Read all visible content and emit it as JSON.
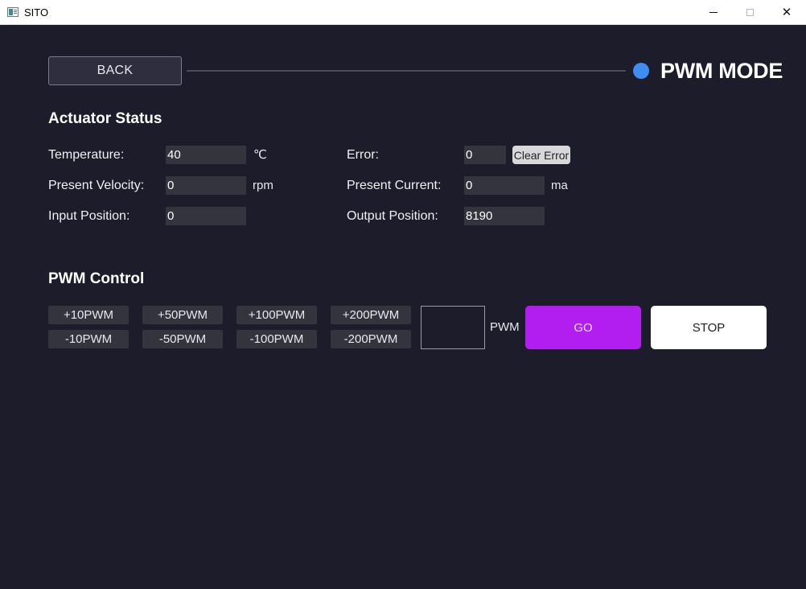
{
  "window": {
    "title": "SITO",
    "minimize_icon": "minimize-icon",
    "maximize_icon": "maximize-icon",
    "close_glyph": "✕"
  },
  "header": {
    "back_label": "BACK",
    "mode_title": "PWM MODE",
    "mode_indicator_color": "#3d8ef0"
  },
  "actuator_status": {
    "title": "Actuator Status",
    "temperature": {
      "label": "Temperature:",
      "value": "40",
      "unit": "℃"
    },
    "present_velocity": {
      "label": "Present Velocity:",
      "value": "0",
      "unit": "rpm"
    },
    "input_position": {
      "label": "Input Position:",
      "value": "0"
    },
    "error": {
      "label": "Error:",
      "value": "0",
      "clear_label": "Clear Error"
    },
    "present_current": {
      "label": "Present Current:",
      "value": "0",
      "unit": "ma"
    },
    "output_position": {
      "label": "Output Position:",
      "value": "8190"
    }
  },
  "pwm_control": {
    "title": "PWM Control",
    "increase_buttons": [
      "+10PWM",
      "+50PWM",
      "+100PWM",
      "+200PWM"
    ],
    "decrease_buttons": [
      "-10PWM",
      "-50PWM",
      "-100PWM",
      "-200PWM"
    ],
    "input_value": "",
    "unit": "PWM",
    "go_label": "GO",
    "stop_label": "STOP",
    "go_color": "#b21ef0"
  }
}
